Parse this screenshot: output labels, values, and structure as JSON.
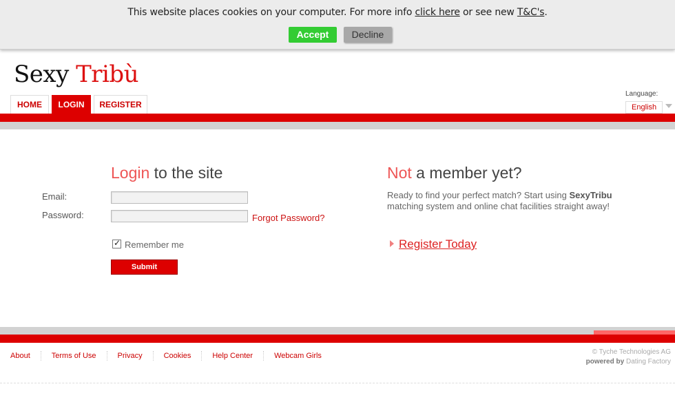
{
  "cookie_bar": {
    "text_before": "This website places cookies on your computer. For more info ",
    "click_here": "click here",
    "text_middle": " or see new ",
    "tc_link": "T&C's",
    "text_after": ".",
    "accept": "Accept",
    "decline": "Decline"
  },
  "logo": {
    "part1": "Sexy ",
    "part2": "Tribù"
  },
  "nav": {
    "home": "HOME",
    "login": "LOGIN",
    "register": "REGISTER"
  },
  "language": {
    "label": "Language:",
    "selected": "English"
  },
  "login": {
    "heading_highlight": "Login",
    "heading_rest": " to the site",
    "email_label": "Email:",
    "password_label": "Password:",
    "email_value": "",
    "password_value": "",
    "forgot": "Forgot Password?",
    "remember": "Remember me",
    "submit": "Submit"
  },
  "member": {
    "heading_highlight": "Not",
    "heading_rest": " a member yet?",
    "text_before": "Ready to find your perfect match? Start using ",
    "brand": "SexyTribu",
    "text_after": " matching system and online chat facilities straight away!",
    "register_link": "Register Today"
  },
  "footer": {
    "links": [
      "About",
      "Terms of Use",
      "Privacy",
      "Cookies",
      "Help Center",
      "Webcam Girls"
    ],
    "copyright_symbol": "©",
    "company": "Tyche Technologies AG",
    "powered_by": "powered by",
    "powered_name": "Dating Factory"
  },
  "colors": {
    "accent": "#dd0000",
    "highlight": "#ee5555",
    "accept": "#33cc33"
  }
}
